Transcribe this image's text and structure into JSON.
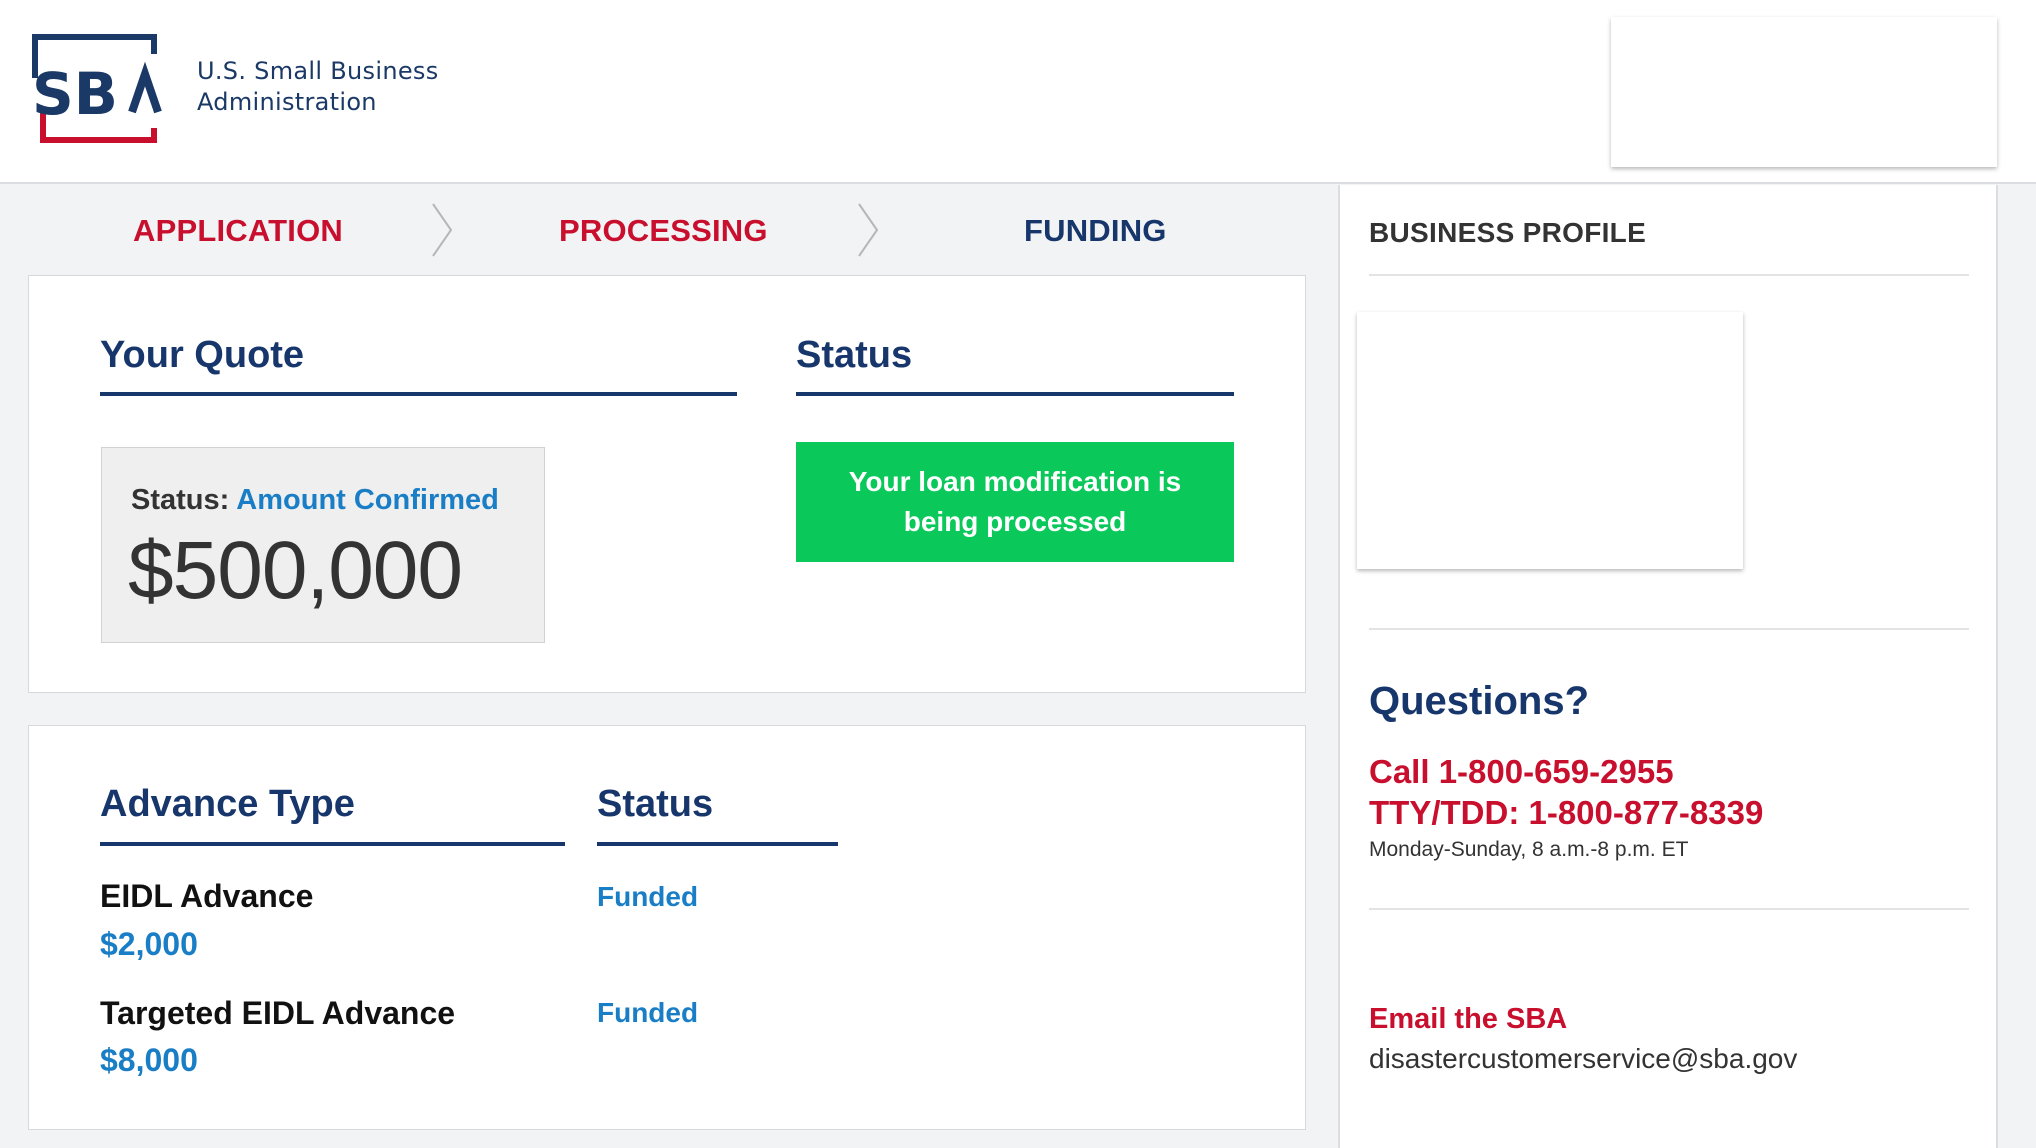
{
  "header": {
    "logo_alt": "SBA",
    "org_line1": "U.S. Small Business",
    "org_line2": "Administration",
    "colors": {
      "navy": "#1a3966",
      "red": "#c8102e"
    }
  },
  "steps": [
    {
      "label": "APPLICATION",
      "state": "done"
    },
    {
      "label": "PROCESSING",
      "state": "done"
    },
    {
      "label": "FUNDING",
      "state": "current"
    }
  ],
  "quote": {
    "title": "Your Quote",
    "status_label": "Status:",
    "status_value": "Amount Confirmed",
    "amount": "$500,000"
  },
  "status": {
    "title": "Status",
    "banner_line1": "Your loan modification is",
    "banner_line2": "being processed",
    "banner_color": "#0ac95a"
  },
  "advances": {
    "type_header": "Advance Type",
    "status_header": "Status",
    "rows": [
      {
        "name": "EIDL Advance",
        "amount": "$2,000",
        "status": "Funded"
      },
      {
        "name": "Targeted EIDL Advance",
        "amount": "$8,000",
        "status": "Funded"
      }
    ]
  },
  "sidebar": {
    "profile_title": "BUSINESS PROFILE",
    "questions_title": "Questions?",
    "call": "Call 1-800-659-2955",
    "tty": "TTY/TDD: 1-800-877-8339",
    "hours": "Monday-Sunday, 8 a.m.-8 p.m. ET",
    "email_title": "Email the SBA",
    "email": "disastercustomerservice@sba.gov"
  },
  "icons": [
    "sba-logo-icon",
    "chevron-right-icon"
  ]
}
